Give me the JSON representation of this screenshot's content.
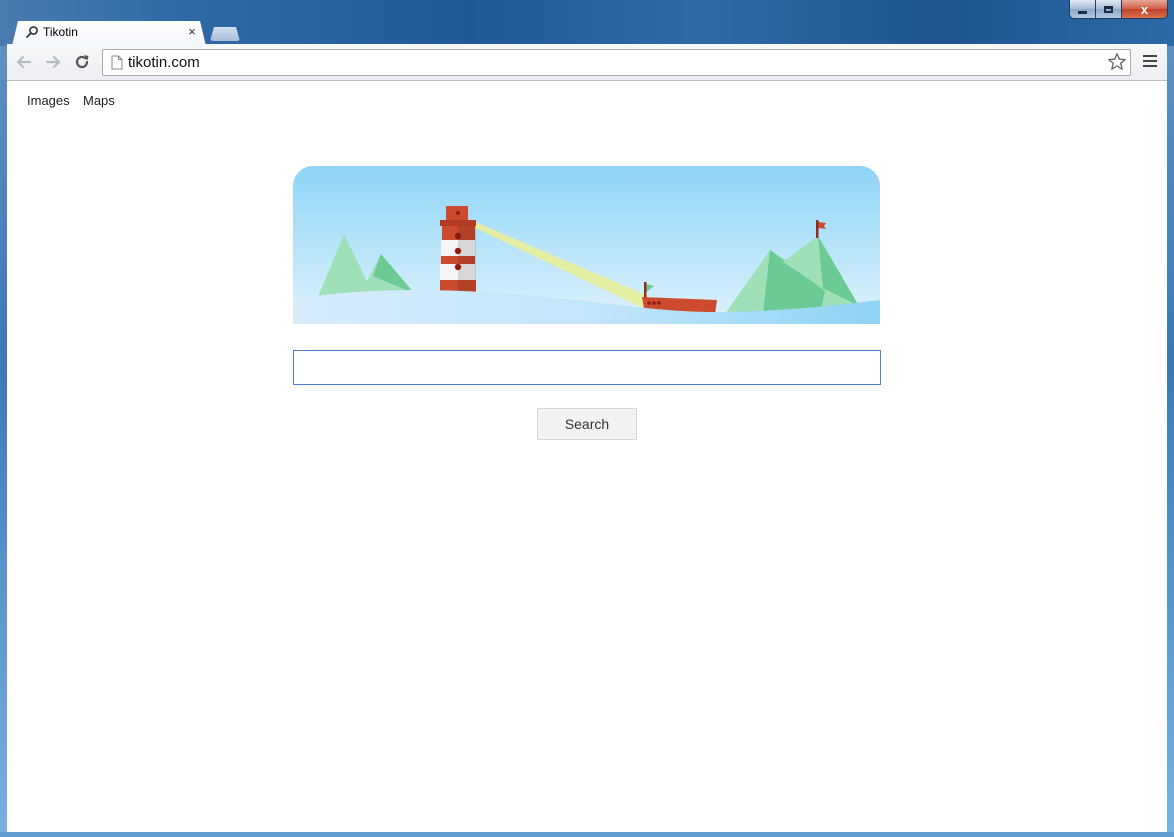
{
  "window": {
    "caption_close_glyph": "x"
  },
  "tabs": [
    {
      "title": "Tikotin",
      "close_glyph": "×"
    }
  ],
  "toolbar": {
    "url": "tikotin.com"
  },
  "page": {
    "links": [
      {
        "label": "Images"
      },
      {
        "label": "Maps"
      }
    ],
    "search": {
      "value": "",
      "button_label": "Search"
    }
  },
  "colors": {
    "sky_top": "#8ed4f7",
    "sky_bottom": "#e0f3fd",
    "mountain_light": "#9fe0b9",
    "mountain_dark": "#6ccb94",
    "lighthouse_red": "#cc4a2e",
    "ship_red": "#cc4a2e",
    "beam": "#e8f09a",
    "water": "#bfe4fb",
    "input_border": "#4d7bd1"
  }
}
